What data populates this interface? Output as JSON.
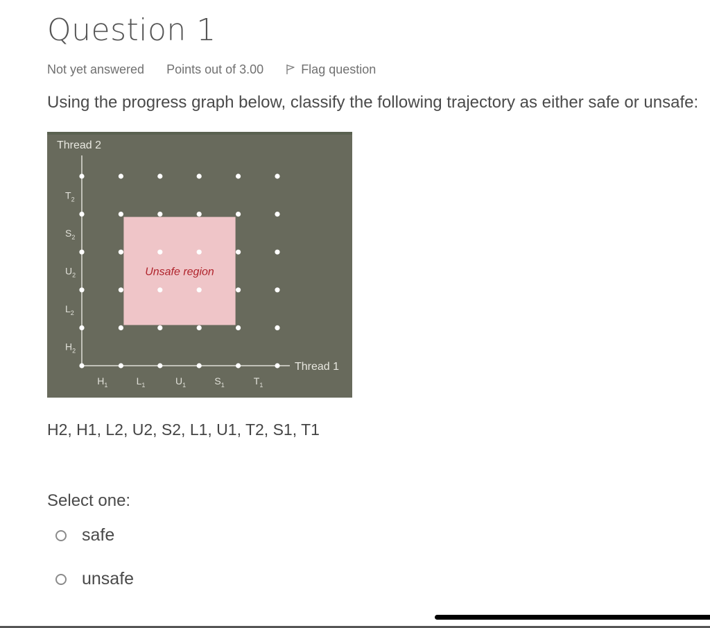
{
  "header": {
    "title": "Question 1",
    "status": "Not yet answered",
    "points": "Points out of 3.00",
    "flag_label": "Flag question"
  },
  "question": {
    "text": "Using the progress graph below, classify the following trajectory as either safe or unsafe:",
    "trajectory": "H2, H1, L2, U2, S2, L1, U1, T2, S1, T1"
  },
  "graph": {
    "y_axis_title": "Thread 2",
    "x_axis_title": "Thread 1",
    "x_labels": [
      {
        "main": "H",
        "sub": "1"
      },
      {
        "main": "L",
        "sub": "1"
      },
      {
        "main": "U",
        "sub": "1"
      },
      {
        "main": "S",
        "sub": "1"
      },
      {
        "main": "T",
        "sub": "1"
      }
    ],
    "y_labels": [
      {
        "main": "H",
        "sub": "2"
      },
      {
        "main": "L",
        "sub": "2"
      },
      {
        "main": "U",
        "sub": "2"
      },
      {
        "main": "S",
        "sub": "2"
      },
      {
        "main": "T",
        "sub": "2"
      }
    ],
    "unsafe_label": "Unsafe region",
    "unsafe_region": {
      "x_from_step": 1,
      "x_to_step": 4,
      "y_from_step": 1,
      "y_to_step": 4
    },
    "grid_points_per_axis": 6,
    "colors": {
      "background": "#686a5c",
      "unsafe_fill": "#efc5c8",
      "unsafe_text": "#b0242c",
      "points": "#ffffff",
      "axis": "#e0e0d8"
    }
  },
  "answer": {
    "prompt": "Select one:",
    "options": [
      "safe",
      "unsafe"
    ]
  }
}
